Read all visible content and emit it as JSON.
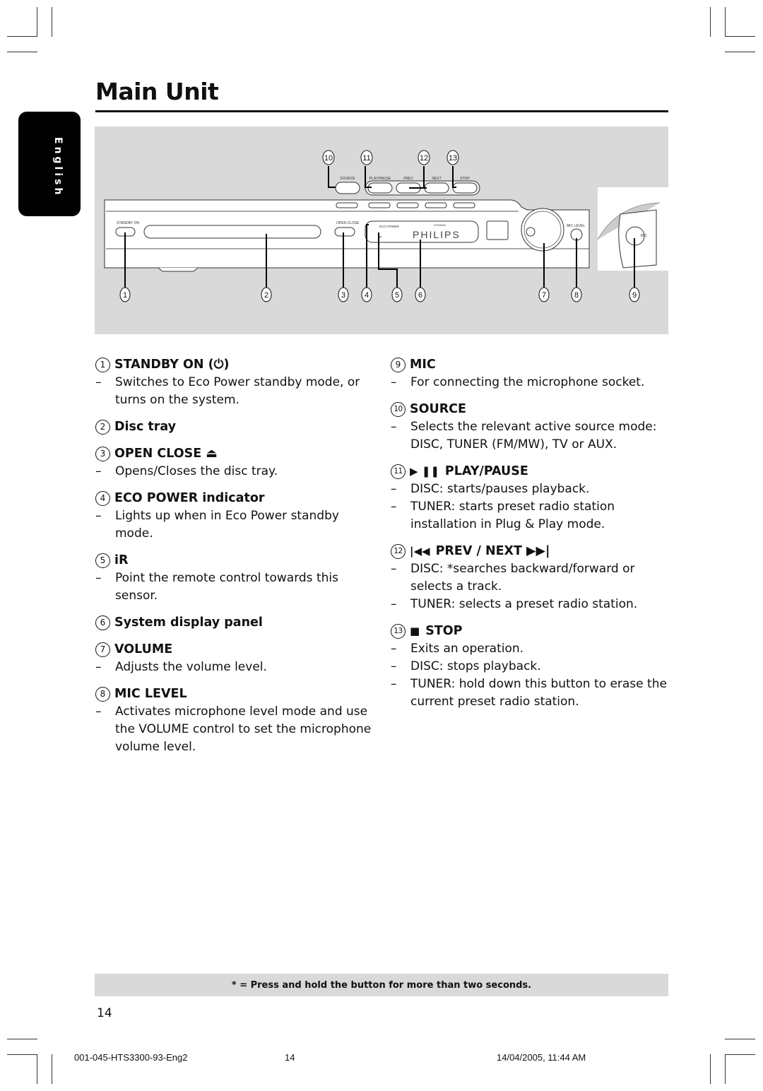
{
  "page": {
    "title": "Main Unit",
    "language_tab": "English",
    "page_number": "14",
    "footnote": "* = Press and hold the button for more than two seconds.",
    "footer": {
      "doc_id": "001-045-HTS3300-93-Eng2",
      "page": "14",
      "timestamp": "14/04/2005, 11:44 AM"
    }
  },
  "figure": {
    "device_labels": {
      "standby": "STANDBY ON",
      "open_close": "OPEN CLOSE",
      "eco_power": "ECO POWER",
      "ir": "iR",
      "brand": "PHILIPS",
      "brand_sub": "HTS3300",
      "mic_level": "MIC LEVEL",
      "mic": "MIC",
      "source": "SOURCE",
      "play_pause": "PLAY/PAUSE",
      "prev": "PREV",
      "next": "NEXT",
      "stop": "STOP"
    },
    "callouts": [
      "1",
      "2",
      "3",
      "4",
      "5",
      "6",
      "7",
      "8",
      "9",
      "10",
      "11",
      "12",
      "13"
    ]
  },
  "items_left": [
    {
      "num": "1",
      "title": "STANDBY ON (⏻)",
      "symbol": "",
      "lines": [
        "Switches to Eco Power standby mode, or turns on the system."
      ]
    },
    {
      "num": "2",
      "title": "Disc tray",
      "symbol": "",
      "lines": []
    },
    {
      "num": "3",
      "title": "OPEN CLOSE ⏏",
      "symbol": "",
      "lines": [
        "Opens/Closes the disc tray."
      ]
    },
    {
      "num": "4",
      "title": "ECO POWER indicator",
      "symbol": "",
      "lines": [
        "Lights up when in Eco Power standby mode."
      ]
    },
    {
      "num": "5",
      "title": "iR",
      "symbol": "",
      "lines": [
        "Point the remote control towards this sensor."
      ]
    },
    {
      "num": "6",
      "title": "System display panel",
      "symbol": "",
      "lines": []
    },
    {
      "num": "7",
      "title": "VOLUME",
      "symbol": "",
      "lines": [
        "Adjusts the volume level."
      ]
    },
    {
      "num": "8",
      "title": "MIC LEVEL",
      "symbol": "",
      "lines": [
        "Activates microphone level mode and use the VOLUME control to set the microphone volume level."
      ]
    }
  ],
  "items_right": [
    {
      "num": "9",
      "title": "MIC",
      "symbol": "",
      "lines": [
        "For connecting the microphone socket."
      ]
    },
    {
      "num": "10",
      "title": "SOURCE",
      "symbol": "",
      "lines": [
        "Selects the relevant active source mode: DISC, TUNER (FM/MW), TV or AUX."
      ]
    },
    {
      "num": "11",
      "title": "PLAY/PAUSE",
      "symbol": "▶ ❚❚",
      "lines": [
        "DISC: starts/pauses playback.",
        "TUNER: starts preset radio station installation in Plug & Play mode."
      ]
    },
    {
      "num": "12",
      "title": "PREV / NEXT ▶▶|",
      "symbol": "|◀◀",
      "lines": [
        "DISC: *searches backward/forward or selects a track.",
        "TUNER: selects a preset radio station."
      ]
    },
    {
      "num": "13",
      "title": "STOP",
      "symbol": "■",
      "lines": [
        "Exits an operation.",
        "DISC: stops playback.",
        "TUNER: hold down this button to erase the current preset radio station."
      ]
    }
  ]
}
